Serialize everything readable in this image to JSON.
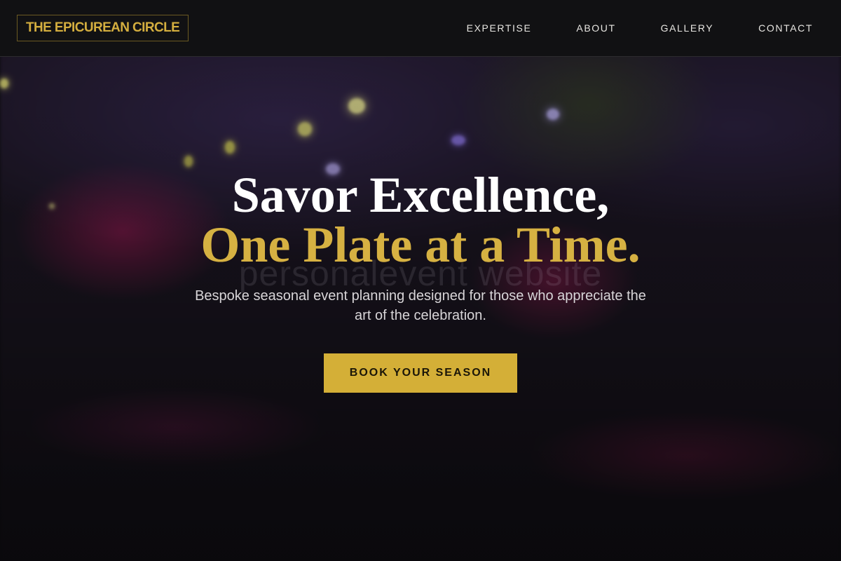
{
  "header": {
    "logo_text": "THE EPICUREAN CIRCLE",
    "nav": [
      "EXPERTISE",
      "ABOUT",
      "GALLERY",
      "CONTACT"
    ]
  },
  "hero": {
    "title_line_1": "Savor Excellence,",
    "title_line_2": "One Plate at a Time.",
    "subtitle": "Bespoke seasonal event planning designed for those who appreciate the art of the celebration.",
    "cta_label": "BOOK YOUR SEASON",
    "background_watermark": "personalevent website"
  },
  "colors": {
    "accent_gold": "#d4af37",
    "header_bg": "#111113",
    "text_light": "#ffffff"
  }
}
